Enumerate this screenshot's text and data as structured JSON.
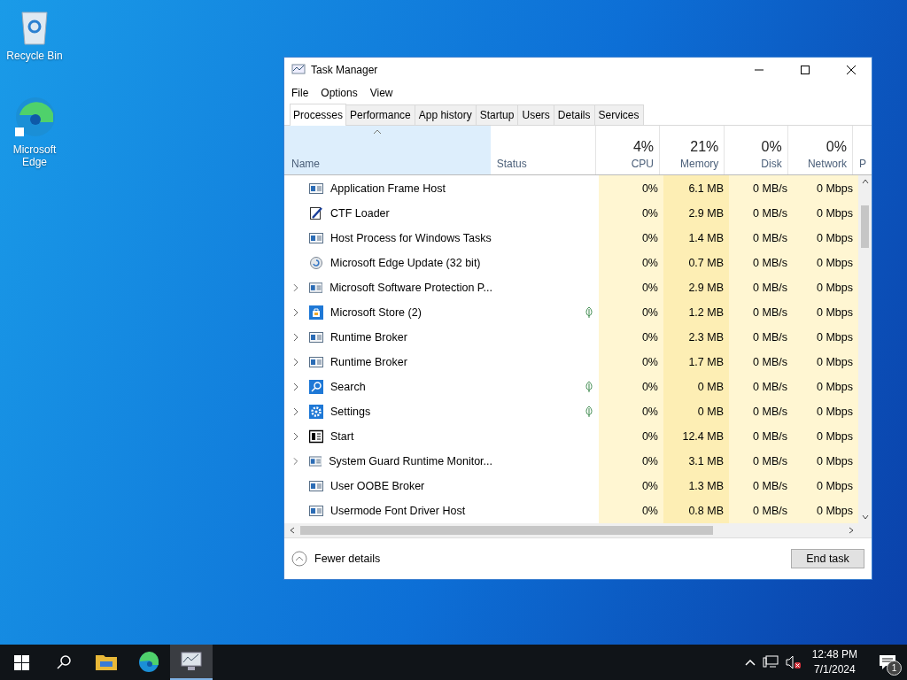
{
  "desktop_icons": [
    {
      "label": "Recycle Bin",
      "kind": "bin"
    },
    {
      "label": "Microsoft Edge",
      "kind": "edge"
    }
  ],
  "window": {
    "title": "Task Manager",
    "menu": [
      "File",
      "Options",
      "View"
    ],
    "tabs": [
      {
        "label": "Processes",
        "selected": true
      },
      {
        "label": "Performance",
        "selected": false
      },
      {
        "label": "App history",
        "selected": false
      },
      {
        "label": "Startup",
        "selected": false
      },
      {
        "label": "Users",
        "selected": false
      },
      {
        "label": "Details",
        "selected": false
      },
      {
        "label": "Services",
        "selected": false
      }
    ],
    "columns": [
      {
        "label": "Name",
        "sorted": true
      },
      {
        "label": "Status",
        "sorted": false
      },
      {
        "label": "CPU",
        "usage": "4%",
        "sorted": false
      },
      {
        "label": "Memory",
        "usage": "21%",
        "sorted": false
      },
      {
        "label": "Disk",
        "usage": "0%",
        "sorted": false
      },
      {
        "label": "Network",
        "usage": "0%",
        "sorted": false
      },
      {
        "label": "P",
        "sorted": false
      }
    ],
    "rows": [
      {
        "name": "Application Frame Host",
        "kind": "app",
        "expandable": false,
        "suspended": false,
        "cpu": "0%",
        "memory": "6.1 MB",
        "disk": "0 MB/s",
        "network": "0 Mbps"
      },
      {
        "name": "CTF Loader",
        "kind": "pen",
        "expandable": false,
        "suspended": false,
        "cpu": "0%",
        "memory": "2.9 MB",
        "disk": "0 MB/s",
        "network": "0 Mbps"
      },
      {
        "name": "Host Process for Windows Tasks",
        "kind": "app",
        "expandable": false,
        "suspended": false,
        "cpu": "0%",
        "memory": "1.4 MB",
        "disk": "0 MB/s",
        "network": "0 Mbps"
      },
      {
        "name": "Microsoft Edge Update (32 bit)",
        "kind": "update",
        "expandable": false,
        "suspended": false,
        "cpu": "0%",
        "memory": "0.7 MB",
        "disk": "0 MB/s",
        "network": "0 Mbps"
      },
      {
        "name": "Microsoft Software Protection P...",
        "kind": "app",
        "expandable": true,
        "suspended": false,
        "cpu": "0%",
        "memory": "2.9 MB",
        "disk": "0 MB/s",
        "network": "0 Mbps"
      },
      {
        "name": "Microsoft Store (2)",
        "kind": "store",
        "expandable": true,
        "suspended": true,
        "cpu": "0%",
        "memory": "1.2 MB",
        "disk": "0 MB/s",
        "network": "0 Mbps"
      },
      {
        "name": "Runtime Broker",
        "kind": "app",
        "expandable": true,
        "suspended": false,
        "cpu": "0%",
        "memory": "2.3 MB",
        "disk": "0 MB/s",
        "network": "0 Mbps"
      },
      {
        "name": "Runtime Broker",
        "kind": "app",
        "expandable": true,
        "suspended": false,
        "cpu": "0%",
        "memory": "1.7 MB",
        "disk": "0 MB/s",
        "network": "0 Mbps"
      },
      {
        "name": "Search",
        "kind": "search",
        "expandable": true,
        "suspended": true,
        "cpu": "0%",
        "memory": "0 MB",
        "disk": "0 MB/s",
        "network": "0 Mbps"
      },
      {
        "name": "Settings",
        "kind": "gear",
        "expandable": true,
        "suspended": true,
        "cpu": "0%",
        "memory": "0 MB",
        "disk": "0 MB/s",
        "network": "0 Mbps"
      },
      {
        "name": "Start",
        "kind": "start",
        "expandable": true,
        "suspended": false,
        "cpu": "0%",
        "memory": "12.4 MB",
        "disk": "0 MB/s",
        "network": "0 Mbps"
      },
      {
        "name": "System Guard Runtime Monitor...",
        "kind": "app",
        "expandable": true,
        "suspended": false,
        "cpu": "0%",
        "memory": "3.1 MB",
        "disk": "0 MB/s",
        "network": "0 Mbps"
      },
      {
        "name": "User OOBE Broker",
        "kind": "app",
        "expandable": false,
        "suspended": false,
        "cpu": "0%",
        "memory": "1.3 MB",
        "disk": "0 MB/s",
        "network": "0 Mbps"
      },
      {
        "name": "Usermode Font Driver Host",
        "kind": "app",
        "expandable": false,
        "suspended": false,
        "cpu": "0%",
        "memory": "0.8 MB",
        "disk": "0 MB/s",
        "network": "0 Mbps"
      }
    ],
    "footer": {
      "toggle": "Fewer details",
      "button": "End task"
    }
  },
  "taskbar": {
    "items": [
      {
        "kind": "start",
        "selected": false
      },
      {
        "kind": "search",
        "selected": false
      },
      {
        "kind": "folder",
        "selected": false
      },
      {
        "kind": "edge",
        "selected": false
      },
      {
        "kind": "taskmgr",
        "selected": true
      }
    ],
    "time": "12:48 PM",
    "date": "7/1/2024",
    "notification_count": "1"
  }
}
